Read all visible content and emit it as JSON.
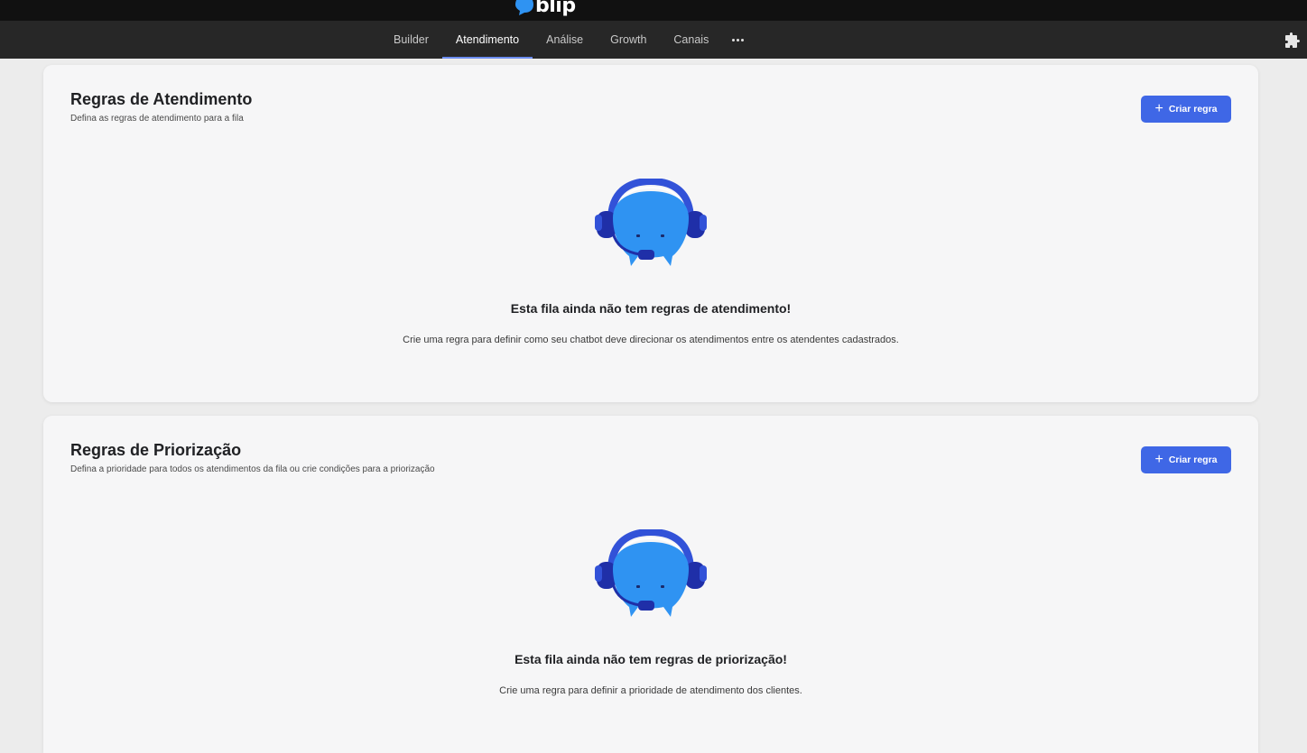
{
  "app": {
    "brand": "blip"
  },
  "nav": {
    "tabs": [
      {
        "label": "Builder"
      },
      {
        "label": "Atendimento"
      },
      {
        "label": "Análise"
      },
      {
        "label": "Growth"
      },
      {
        "label": "Canais"
      }
    ],
    "active_tab": "Atendimento"
  },
  "sections": [
    {
      "title": "Regras de Atendimento",
      "subtitle": "Defina as regras de atendimento para a fila",
      "button_label": "Criar regra",
      "empty_title": "Esta fila ainda não tem regras de atendimento!",
      "empty_description": "Crie uma regra para definir como seu chatbot deve direcionar os atendimentos entre os atendentes cadastrados."
    },
    {
      "title": "Regras de Priorização",
      "subtitle": "Defina a prioridade para todos os atendimentos da fila ou crie condições para a priorização",
      "button_label": "Criar regra",
      "empty_title": "Esta fila ainda não tem regras de priorização!",
      "empty_description": "Crie uma regra para definir a prioridade de atendimento dos clientes."
    }
  ],
  "colors": {
    "accent": "#3f67e6",
    "active_tab_underline": "#6b8cf0",
    "topbar": "#111111",
    "navbar": "#272727",
    "mascot_body": "#2f93f2",
    "mascot_headset": "#3252d8",
    "mascot_dark": "#1f2fa8"
  },
  "icons": {
    "plus": "plus-icon",
    "more": "more-horizontal-icon",
    "extensions": "puzzle-icon",
    "logo": "blip-bubble-icon"
  }
}
